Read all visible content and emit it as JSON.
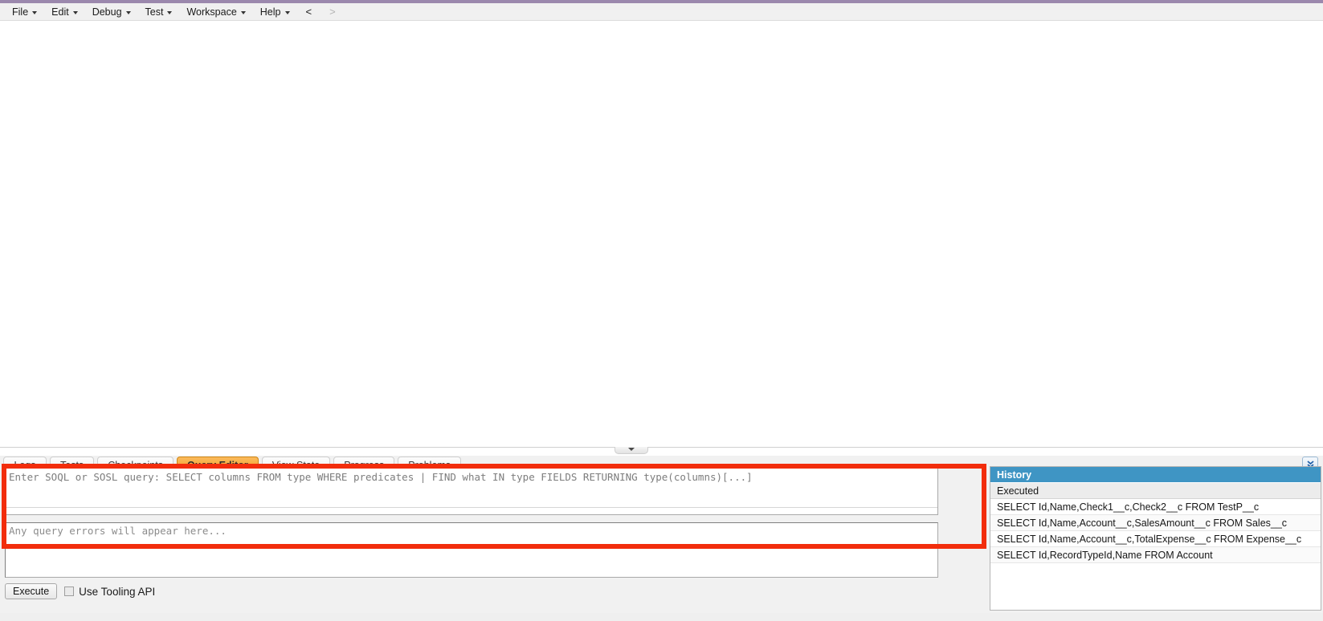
{
  "menubar": {
    "items": [
      {
        "label": "File",
        "has_caret": true
      },
      {
        "label": "Edit",
        "has_caret": true
      },
      {
        "label": "Debug",
        "has_caret": true
      },
      {
        "label": "Test",
        "has_caret": true
      },
      {
        "label": "Workspace",
        "has_caret": true
      },
      {
        "label": "Help",
        "has_caret": true
      }
    ],
    "nav_back": "<",
    "nav_forward": ">"
  },
  "bottom_panel": {
    "tabs": [
      {
        "label": "Logs",
        "active": false
      },
      {
        "label": "Tests",
        "active": false
      },
      {
        "label": "Checkpoints",
        "active": false
      },
      {
        "label": "Query Editor",
        "active": true
      },
      {
        "label": "View State",
        "active": false
      },
      {
        "label": "Progress",
        "active": false
      },
      {
        "label": "Problems",
        "active": false
      }
    ],
    "restore_icon": "double-chevron-down-icon"
  },
  "query_editor": {
    "query_placeholder": "Enter SOQL or SOSL query: SELECT columns FROM type WHERE predicates | FIND what IN type FIELDS RETURNING type(columns)[...]",
    "query_value": "",
    "error_placeholder": "Any query errors will appear here...",
    "error_value": "",
    "execute_label": "Execute",
    "tooling_api_label": "Use Tooling API",
    "tooling_api_checked": false
  },
  "history": {
    "title": "History",
    "column_header": "Executed",
    "rows": [
      "SELECT Id,Name,Check1__c,Check2__c FROM TestP__c",
      "SELECT Id,Name,Account__c,SalesAmount__c FROM Sales__c",
      "SELECT Id,Name,Account__c,TotalExpense__c FROM Expense__c",
      "SELECT Id,RecordTypeId,Name FROM Account"
    ]
  },
  "colors": {
    "accent_orange": "#f29a1e",
    "history_blue": "#3f95c4",
    "annotation_red": "#f22d0c",
    "title_purple": "#9b88ad"
  }
}
